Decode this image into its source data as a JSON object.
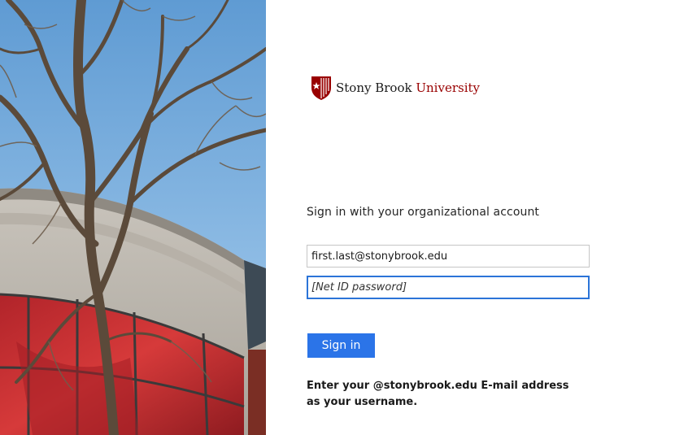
{
  "illustration": {
    "alt": "Campus building behind a bare tree"
  },
  "brand": {
    "name_part1": "Stony Brook",
    "name_part2": "University",
    "logo_icon": "sbu-shield-icon",
    "colors": {
      "brand_red": "#990000"
    }
  },
  "form": {
    "intro": "Sign in with your organizational account",
    "username_value": "first.last@stonybrook.edu",
    "password_placeholder": "[Net ID password]",
    "submit_label": "Sign in",
    "help_text": "Enter your @stonybrook.edu E-mail address as your username."
  },
  "colors": {
    "accent": "#2b74e8",
    "focus_border": "#2b74d8"
  }
}
